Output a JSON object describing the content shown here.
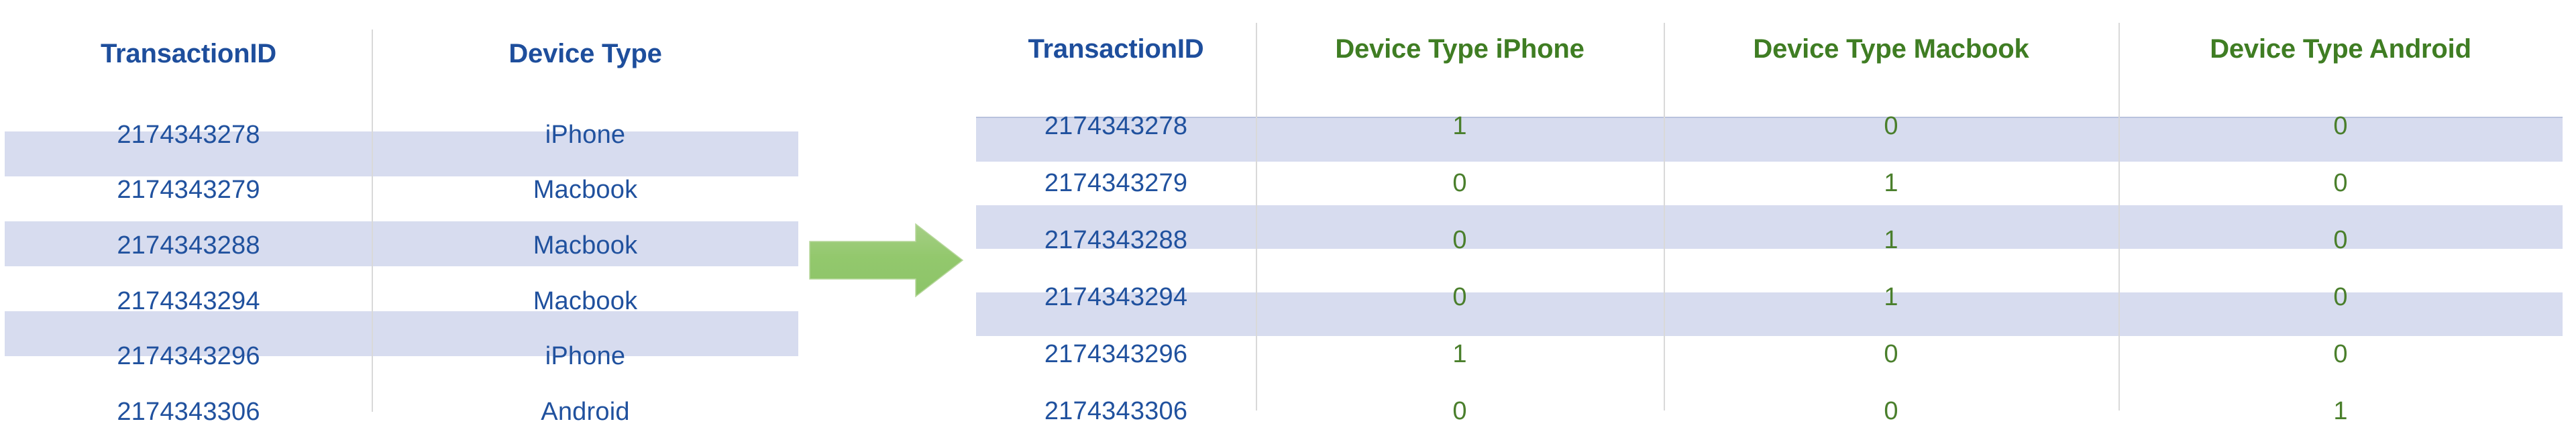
{
  "left_table": {
    "columns": [
      "TransactionID",
      "Device Type"
    ],
    "rows": [
      {
        "transaction_id": "2174343278",
        "device_type": "iPhone"
      },
      {
        "transaction_id": "2174343279",
        "device_type": "Macbook"
      },
      {
        "transaction_id": "2174343288",
        "device_type": "Macbook"
      },
      {
        "transaction_id": "2174343294",
        "device_type": "Macbook"
      },
      {
        "transaction_id": "2174343296",
        "device_type": "iPhone"
      },
      {
        "transaction_id": "2174343306",
        "device_type": "Android"
      }
    ]
  },
  "right_table": {
    "columns": [
      "TransactionID",
      "Device Type iPhone",
      "Device Type Macbook",
      "Device Type Android"
    ],
    "rows": [
      {
        "transaction_id": "2174343278",
        "iphone": "1",
        "macbook": "0",
        "android": "0"
      },
      {
        "transaction_id": "2174343279",
        "iphone": "0",
        "macbook": "1",
        "android": "0"
      },
      {
        "transaction_id": "2174343288",
        "iphone": "0",
        "macbook": "1",
        "android": "0"
      },
      {
        "transaction_id": "2174343294",
        "iphone": "0",
        "macbook": "1",
        "android": "0"
      },
      {
        "transaction_id": "2174343296",
        "iphone": "1",
        "macbook": "0",
        "android": "0"
      },
      {
        "transaction_id": "2174343306",
        "iphone": "0",
        "macbook": "0",
        "android": "1"
      }
    ]
  },
  "arrow": {
    "icon": "arrow-right-icon",
    "direction": "right",
    "color": "#8dc36a"
  },
  "colors": {
    "header_navy": "#1e4e9c",
    "header_green": "#3f7d23",
    "cell_navy": "#20519e",
    "cell_green": "#4a7f2c",
    "stripe": "#d7dcef",
    "separator": "#d9d9d9",
    "background": "#ffffff"
  }
}
